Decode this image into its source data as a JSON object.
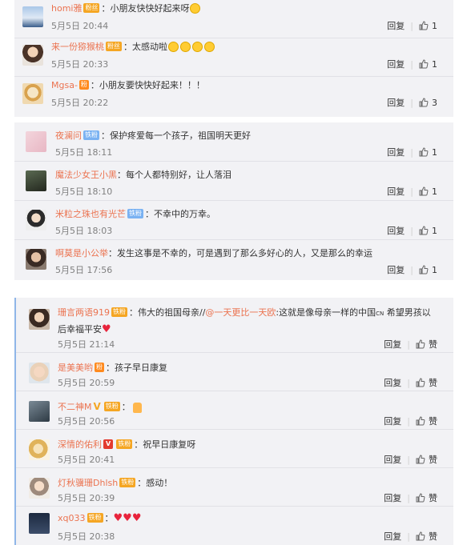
{
  "actions": {
    "reply_label": "回复",
    "separator": "|"
  },
  "section1": {
    "comments": [
      {
        "user": "homi雅",
        "badge": "粉丝",
        "sep": "：",
        "text": "小朋友快快好起来呀",
        "time": "5月5日 20:44",
        "likes": "1"
      },
      {
        "user": "来一份猕猴桃",
        "badge": "粉丝",
        "sep": "：",
        "text": "太感动啦",
        "time": "5月5日 20:33",
        "likes": "1"
      },
      {
        "user": "Mgsa-",
        "badge": "粉",
        "sep": "：",
        "text": "小朋友要快快好起来！！！",
        "time": "5月5日 20:22",
        "likes": "3"
      }
    ]
  },
  "section2": {
    "comments": [
      {
        "user": "夜澜问",
        "badge": "铁粉",
        "sep": "：",
        "text": "保护疼爱每一个孩子，祖国明天更好",
        "time": "5月5日 18:11",
        "likes": "1"
      },
      {
        "user": "魔法少女王小黑",
        "sep": "：",
        "text": "每个人都特别好，让人落泪",
        "time": "5月5日 18:10",
        "likes": "1"
      },
      {
        "user": "米粒之珠也有光芒",
        "badge": "铁粉",
        "sep": "：",
        "text": "不幸中的万幸。",
        "time": "5月5日 18:03",
        "likes": "1"
      },
      {
        "user": "啊莫是小公举",
        "sep": "：",
        "text": "发生这事是不幸的，可是遇到了那么多好心的人，又是那么的幸运",
        "time": "5月5日 17:56",
        "likes": "1"
      }
    ]
  },
  "section3": {
    "like_label": "赞",
    "comments": [
      {
        "user": "珊言两语919",
        "badge": "铁粉",
        "sep": "：",
        "text_a": "伟大的祖国母亲//",
        "mention": "@一天更比一天欧",
        "text_b": ":这就是像母亲一样的中国",
        "tag": "CN",
        "text_c": " 希望男孩以后幸福平安",
        "time": "5月5日 21:14"
      },
      {
        "user": "是美美哟",
        "badge": "粉",
        "sep": "：",
        "text": "孩子早日康复",
        "time": "5月5日 20:59"
      },
      {
        "user": "不二神M",
        "vip": "V",
        "badge": "铁粉",
        "sep": "：",
        "text": "",
        "time": "5月5日 20:56"
      },
      {
        "user": "深情的佑利",
        "vip": "V",
        "badge": "铁粉",
        "sep": "：",
        "text": "祝早日康复呀",
        "time": "5月5日 20:41"
      },
      {
        "user": "灯秋骥珊Dhlsh",
        "badge": "铁粉",
        "sep": "：",
        "text": "感动！",
        "time": "5月5日 20:39"
      },
      {
        "user": "xq033",
        "badge": "铁粉",
        "sep": "：",
        "text": "",
        "time": "5月5日 20:38"
      }
    ]
  },
  "colors": {
    "username": "#eb7350",
    "panel_bg": "#f2f2f5",
    "fan_badge": "#f5a623",
    "iron_fan_badge": "#7ab2f2",
    "heart": "#e8243c",
    "quote_bar": "#8fb6e8"
  },
  "icons": {
    "like": "thumb-up-icon",
    "emoji": "face-emoji-icon",
    "heart": "heart-icon",
    "thumb_emoji": "thumbs-up-emoji-icon"
  }
}
